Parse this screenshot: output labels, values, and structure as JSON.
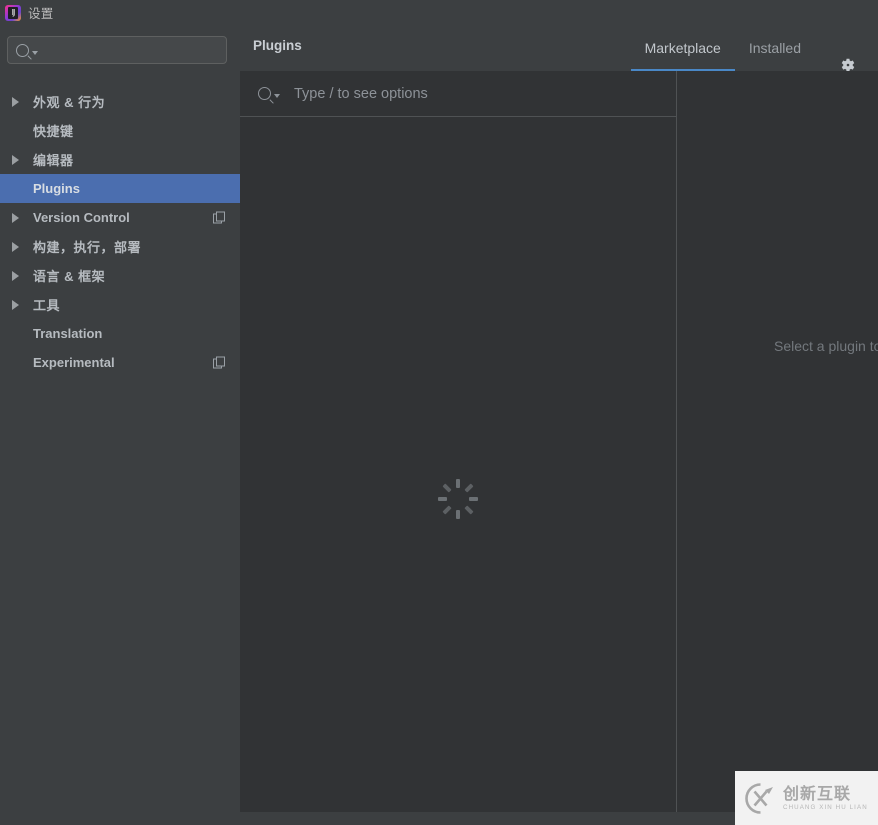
{
  "window": {
    "title": "设置",
    "app_icon": "intellij-idea-icon",
    "icon_label": "IJ"
  },
  "sidebar": {
    "search": {
      "value": "",
      "placeholder": "",
      "icon": "search-icon",
      "caret_icon": "chevron-down-icon"
    },
    "items": [
      {
        "label": "外观 & 行为",
        "expandable": true,
        "selected": false,
        "badge": false,
        "name": "appearance-and-behavior"
      },
      {
        "label": "快捷键",
        "expandable": false,
        "selected": false,
        "badge": false,
        "name": "keymap"
      },
      {
        "label": "编辑器",
        "expandable": true,
        "selected": false,
        "badge": false,
        "name": "editor"
      },
      {
        "label": "Plugins",
        "expandable": false,
        "selected": true,
        "badge": false,
        "name": "plugins"
      },
      {
        "label": "Version Control",
        "expandable": true,
        "selected": false,
        "badge": true,
        "name": "version-control"
      },
      {
        "label": "构建，执行，部署",
        "expandable": true,
        "selected": false,
        "badge": false,
        "name": "build-execution-deployment"
      },
      {
        "label": "语言 & 框架",
        "expandable": true,
        "selected": false,
        "badge": false,
        "name": "languages-and-frameworks"
      },
      {
        "label": "工具",
        "expandable": true,
        "selected": false,
        "badge": false,
        "name": "tools"
      },
      {
        "label": "Translation",
        "expandable": false,
        "selected": false,
        "badge": false,
        "name": "translation"
      },
      {
        "label": "Experimental",
        "expandable": false,
        "selected": false,
        "badge": true,
        "name": "experimental"
      }
    ]
  },
  "main": {
    "title": "Plugins",
    "tabs": [
      {
        "label": "Marketplace",
        "active": true
      },
      {
        "label": "Installed",
        "active": false
      }
    ],
    "settings_icon": "gear-icon",
    "search": {
      "value": "",
      "placeholder": "Type / to see options",
      "icon": "search-icon",
      "caret_icon": "chevron-down-icon"
    },
    "list": {
      "state": "loading",
      "spinner_icon": "loading-spinner-icon"
    },
    "detail": {
      "placeholder": "Select a plugin to see the description"
    }
  },
  "watermark": {
    "logo": "cx-logo-icon",
    "chinese": "创新互联",
    "pinyin": "CHUANG XIN HU LIAN"
  },
  "colors": {
    "accent_blue": "#4b6eaf",
    "tab_underline": "#4a88c7",
    "panel_bg": "#3c3f41",
    "content_bg": "#313335",
    "text": "#b6bbc0"
  }
}
